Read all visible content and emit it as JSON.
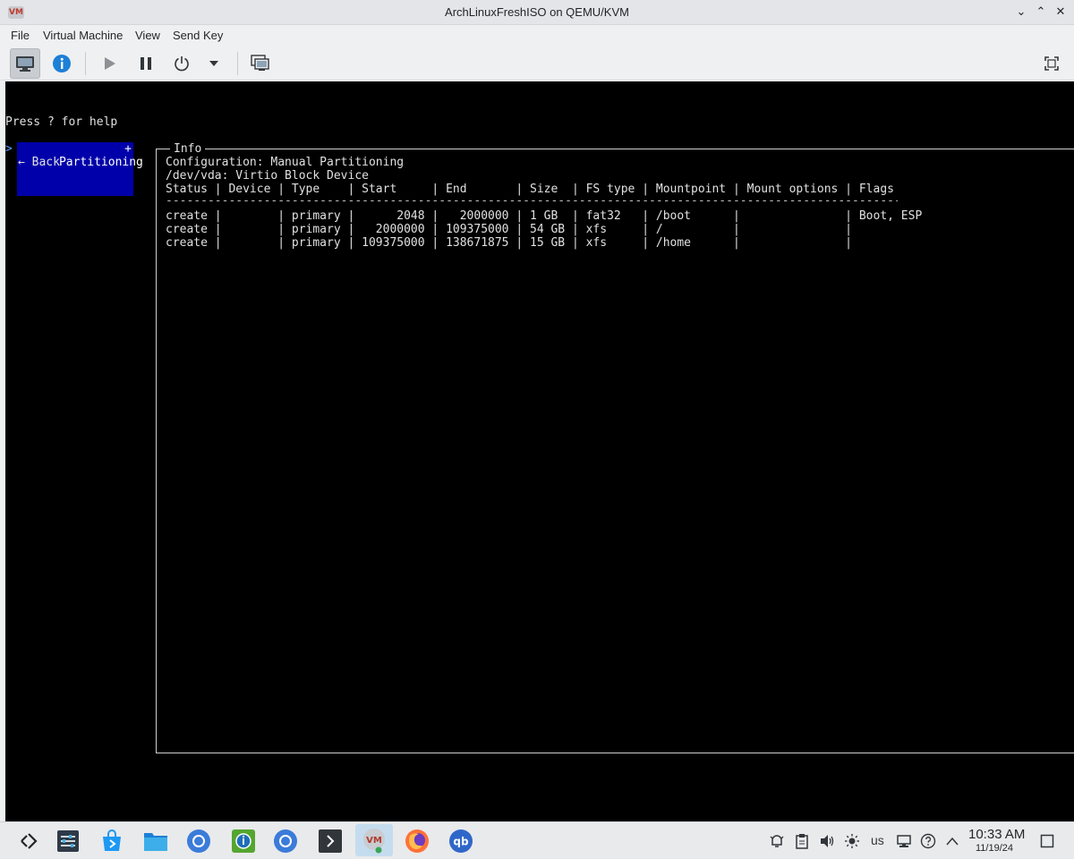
{
  "window": {
    "title": "ArchLinuxFreshISO on QEMU/KVM",
    "logo_text": "VM",
    "controls": {
      "minimize": "⌄",
      "maximize": "⌃",
      "close": "✕"
    }
  },
  "menubar": [
    "File",
    "Virtual Machine",
    "View",
    "Send Key"
  ],
  "toolbar": {
    "buttons": [
      "console-icon",
      "details-info-icon",
      "run-icon",
      "pause-icon",
      "shutdown-icon",
      "shutdown-menu-arrow-icon",
      "snapshots-icon",
      "fullscreen-icon"
    ]
  },
  "console": {
    "help_text": "Press ? for help",
    "menu": {
      "selected_prefix": ">",
      "selected_label": "Partitioning",
      "selected_suffix": "+",
      "back_label": "← Back"
    },
    "info": {
      "title": "Info",
      "config_line": "Configuration: Manual Partitioning",
      "device_line": "/dev/vda: Virtio Block Device",
      "header_line": "Status | Device | Type    | Start     | End       | Size  | FS type | Mountpoint | Mount options | Flags",
      "divider_line": "---------------------------------------------------------------------------------------------------------------------",
      "rows": [
        "create |        | primary |      2048 |   2000000 | 1 GB  | fat32   | /boot      |               | Boot, ESP",
        "create |        | primary |   2000000 | 109375000 | 54 GB | xfs     | /          |               |",
        "create |        | primary | 109375000 | 138671875 | 15 GB | xfs     | /home      |               |"
      ]
    }
  },
  "taskbar": {
    "apps": [
      "app-launcher-icon",
      "system-settings-icon",
      "discover-store-icon",
      "file-manager-icon",
      "chromium-icon",
      "keepassxc-icon",
      "chromium-alt-icon",
      "terminal-icon",
      "virt-manager-icon",
      "firefox-icon",
      "qbittorrent-icon"
    ],
    "tray": {
      "keyboard_layout": "us",
      "time": "10:33 AM",
      "date": "11/19/24"
    }
  },
  "colors": {
    "console_bg": "#000000",
    "console_fg": "#e0e0e0",
    "menu_highlight": "#0000aa"
  }
}
